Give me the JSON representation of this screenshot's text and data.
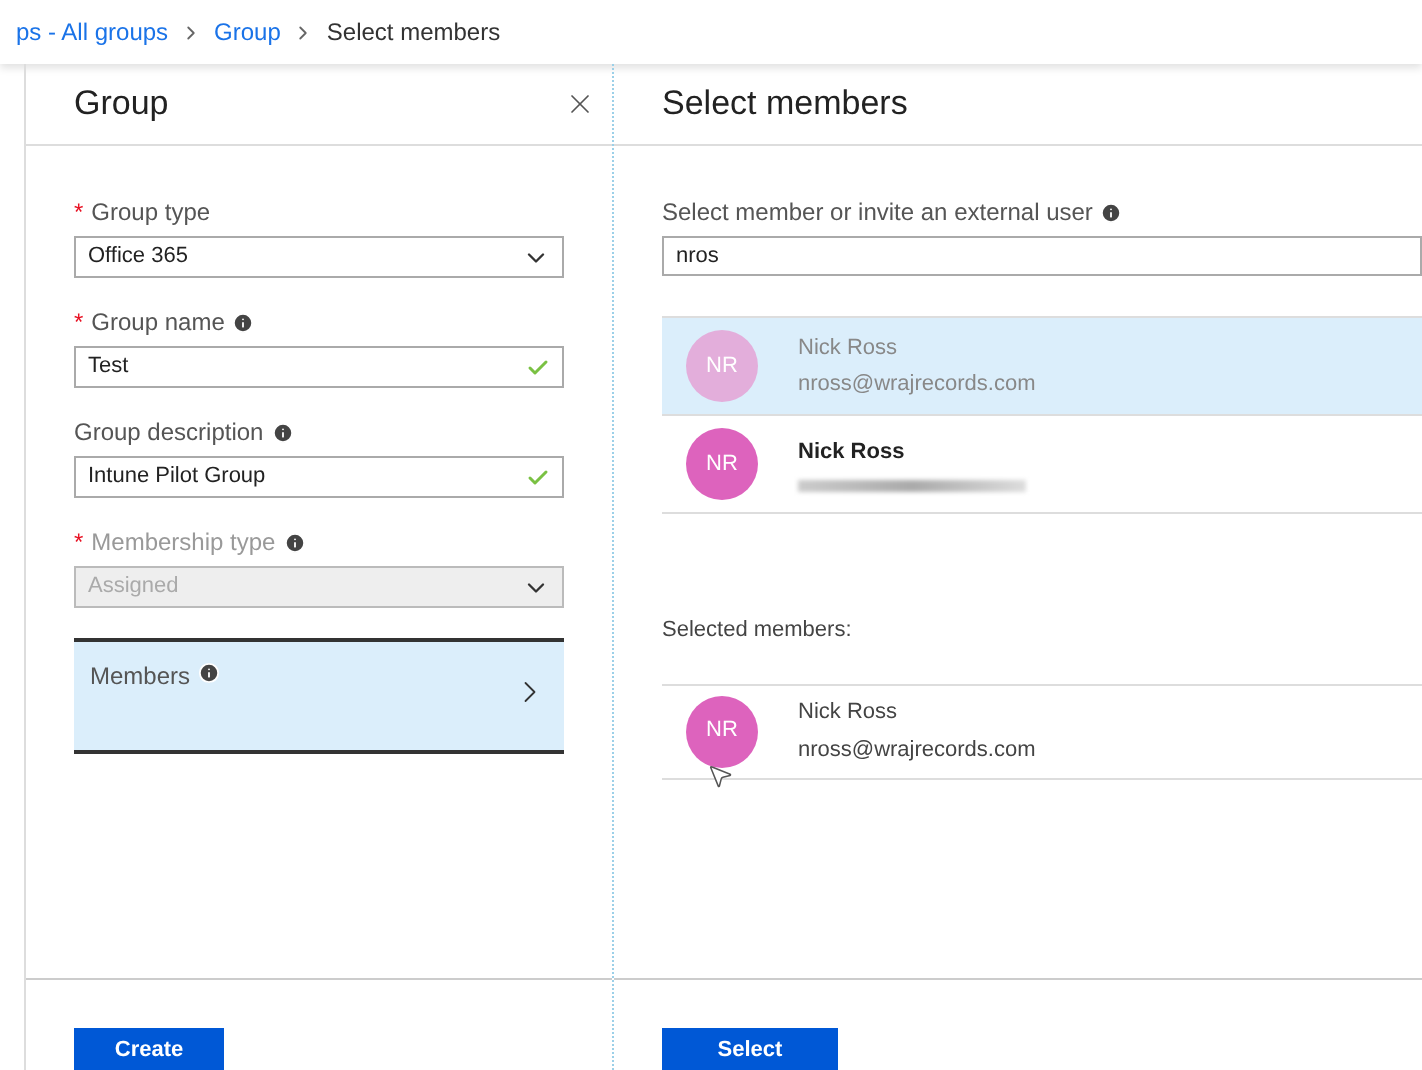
{
  "breadcrumb": [
    {
      "label": "ps - All groups",
      "link": true
    },
    {
      "label": "Group",
      "link": true
    },
    {
      "label": "Select members",
      "link": false
    }
  ],
  "group_panel": {
    "title": "Group",
    "fields": [
      {
        "kind": "select",
        "marker": "*",
        "label": "Group type",
        "info": false,
        "value": "Office 365",
        "disabled": false
      },
      {
        "kind": "text",
        "marker": "*",
        "label": "Group name",
        "info": true,
        "value": "Test",
        "disabled": false,
        "valid": true
      },
      {
        "kind": "text",
        "label": "Group description",
        "info": true,
        "value": "Intune Pilot Group",
        "disabled": false,
        "valid": true
      },
      {
        "kind": "select",
        "marker": "*",
        "label": "Membership type",
        "info": true,
        "value": "Assigned",
        "disabled": true
      }
    ],
    "members_item": {
      "label": "Members",
      "selected": true
    },
    "button": "Create"
  },
  "select_panel": {
    "title": "Select members",
    "search": {
      "label": "Select member or invite an external user",
      "value": "nros"
    },
    "results": [
      {
        "initials": "NR",
        "name": "Nick Ross",
        "email": "nross@wrajrecords.com",
        "selected": true
      },
      {
        "initials": "NR",
        "name": "Nick Ross",
        "selected": false
      }
    ],
    "selected_label": "Selected members:",
    "selected_members": [
      {
        "initials": "NR",
        "name": "Nick Ross",
        "email": "nross@wrajrecords.com"
      }
    ],
    "button": "Select"
  }
}
